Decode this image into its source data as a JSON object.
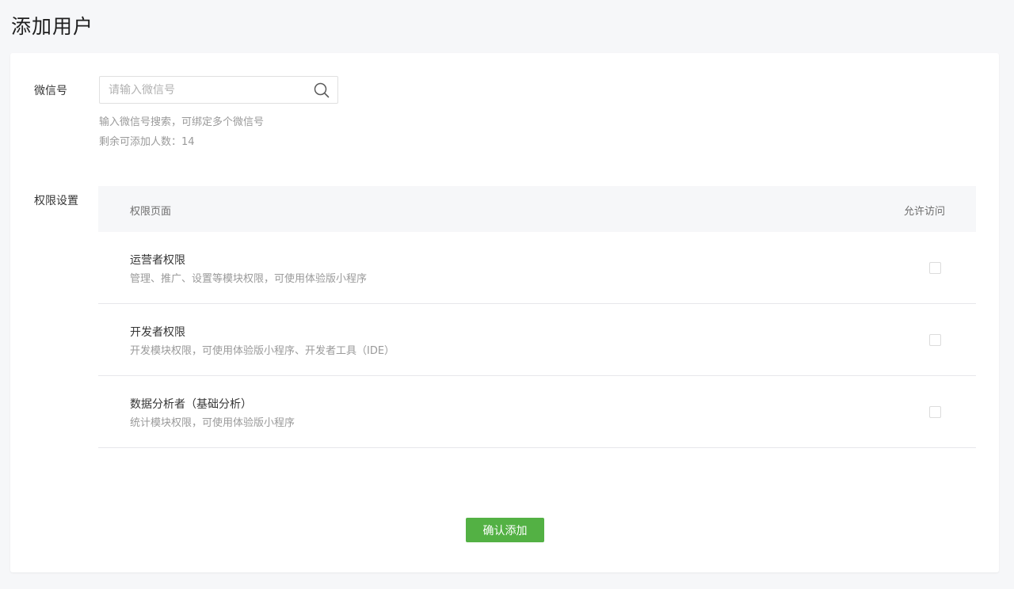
{
  "page": {
    "title": "添加用户"
  },
  "wechat": {
    "label": "微信号",
    "placeholder": "请输入微信号",
    "value": "",
    "hint": "输入微信号搜索，可绑定多个微信号",
    "remaining": "剩余可添加人数：14"
  },
  "permissions": {
    "label": "权限设置",
    "header": {
      "page": "权限页面",
      "allow": "允许访问"
    },
    "rows": [
      {
        "name": "运营者权限",
        "desc": "管理、推广、设置等模块权限，可使用体验版小程序",
        "checked": false
      },
      {
        "name": "开发者权限",
        "desc": "开发模块权限，可使用体验版小程序、开发者工具（IDE）",
        "checked": false
      },
      {
        "name": "数据分析者（基础分析）",
        "desc": "统计模块权限，可使用体验版小程序",
        "checked": false
      }
    ]
  },
  "actions": {
    "confirm": "确认添加"
  },
  "colors": {
    "accent": "#53b144",
    "background": "#f6f7f9"
  }
}
